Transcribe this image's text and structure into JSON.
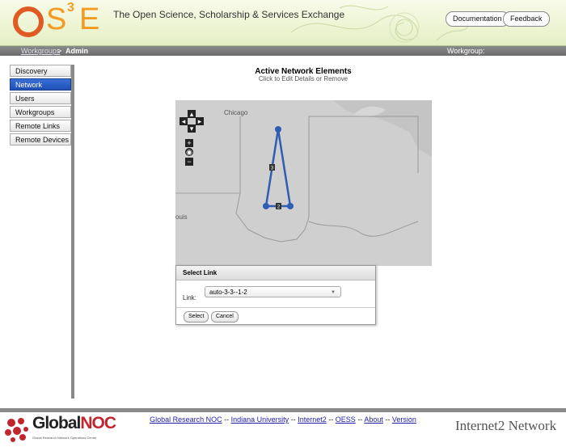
{
  "header": {
    "tagline": "The Open Science, Scholarship & Services Exchange",
    "documentation_label": "Documentation",
    "feedback_label": "Feedback",
    "logo": {
      "o": "O",
      "s": "S",
      "superscript": "3",
      "e": "E"
    }
  },
  "navbar": {
    "breadcrumb_link": "Workgroups",
    "breadcrumb_sep": ">",
    "breadcrumb_current": "Admin",
    "workgroup_label": "Workgroup:"
  },
  "sidebar": {
    "items": [
      {
        "label": "Discovery"
      },
      {
        "label": "Network"
      },
      {
        "label": "Users"
      },
      {
        "label": "Workgroups"
      },
      {
        "label": "Remote Links"
      },
      {
        "label": "Remote Devices"
      }
    ],
    "active_index": 1
  },
  "main": {
    "title": "Active Network Elements",
    "subtitle": "Click to Edit Details or Remove"
  },
  "map": {
    "city_label": "Chicago",
    "city_label_2": "ouis",
    "link_labels": [
      "3",
      "2"
    ],
    "link_color": "#2e5db3"
  },
  "dialog": {
    "title": "Select Link",
    "field_label": "Link:",
    "selected_value": "auto-3-3--1-2",
    "select_button": "Select",
    "cancel_button": "Cancel"
  },
  "footer": {
    "links": [
      "Global Research NOC",
      "Indiana University",
      "Internet2",
      "OESS",
      "About",
      "Version"
    ],
    "separator": "--",
    "globalnoc_word_a": "Global",
    "globalnoc_word_b": "NOC",
    "globalnoc_sub": "Global Research Network Operations Center",
    "internet2_word": "Internet2 Network"
  }
}
